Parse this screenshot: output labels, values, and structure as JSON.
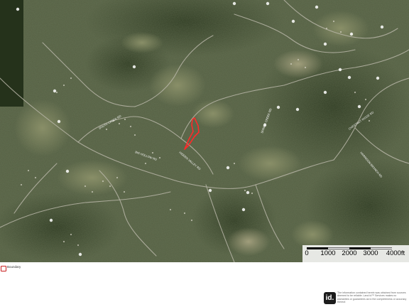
{
  "scale_bar": {
    "ticks": [
      "0",
      "1000",
      "2000",
      "3000",
      "4000ft"
    ]
  },
  "legend": {
    "boundary_label": "Boundary",
    "boundary_color": "#c81e1e"
  },
  "footer": {
    "logo_text": "id.",
    "disclaimer": "The information contained herein was obtained from sources deemed to be reliable. Land id™ Services makes no warranties or guarantees as to the completeness or accuracy thereof."
  },
  "map": {
    "imagery": "satellite",
    "boundary_color": "#ff2a2a",
    "road_labels": [
      "SOUTH CREEK RD",
      "BIG HOLLOW RD",
      "HIDDEN VALLEY RD",
      "SPRING CREEK RD",
      "CHESTNUT RIDGE RD",
      "HARRISON BRANCH RD"
    ]
  }
}
